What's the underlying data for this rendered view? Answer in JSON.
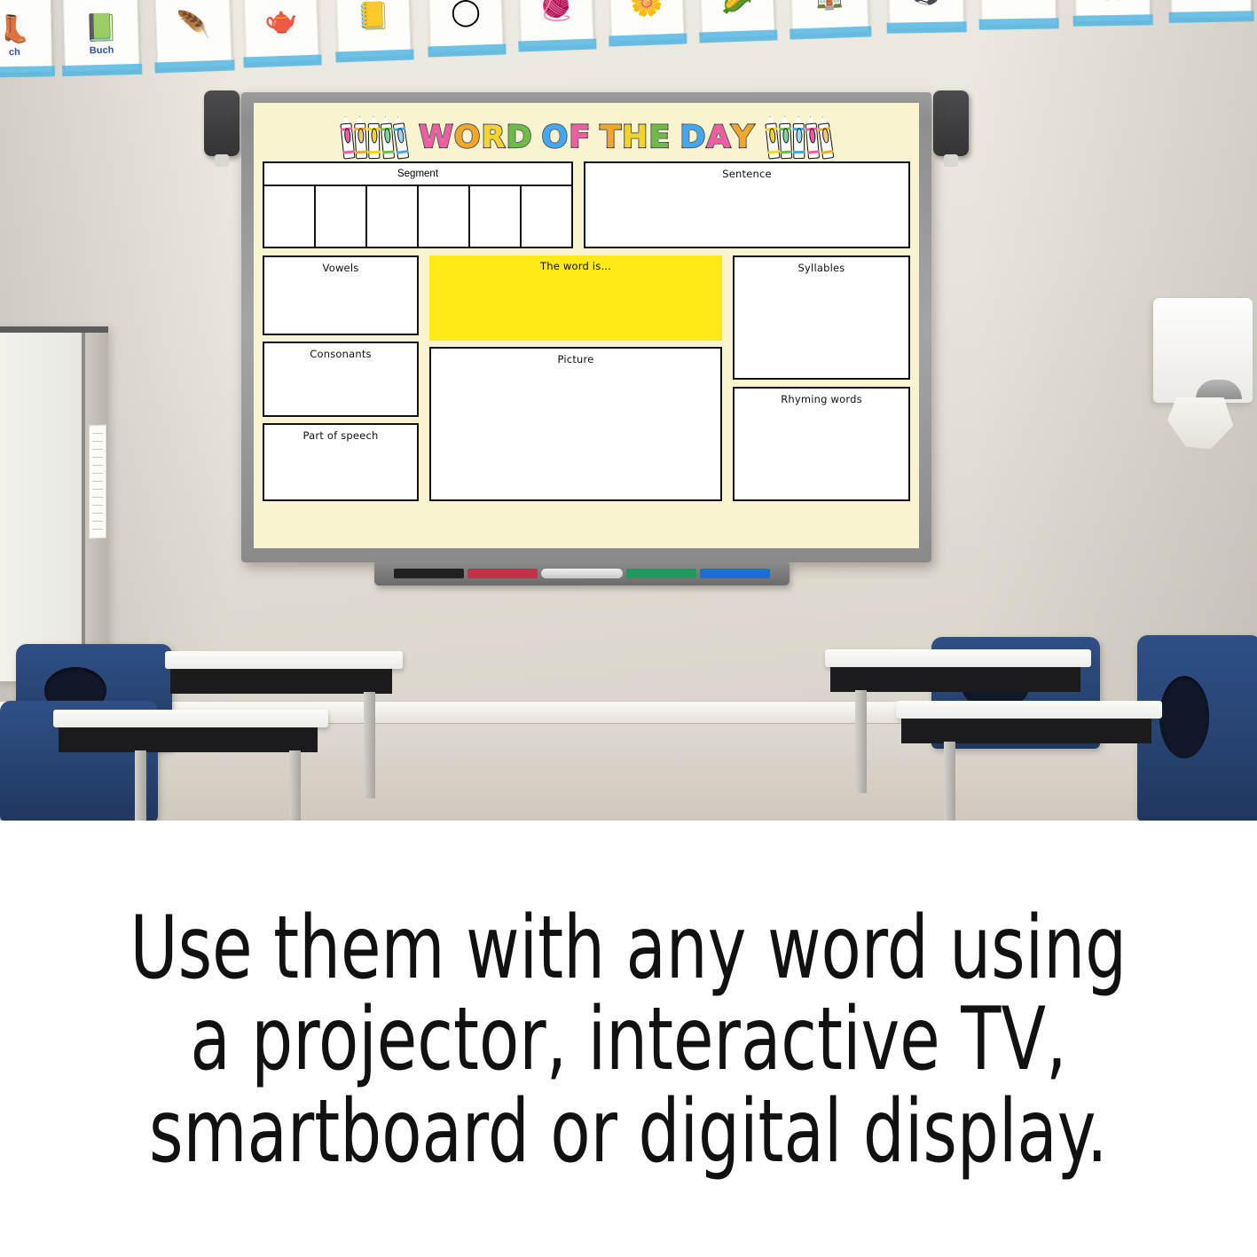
{
  "scene": {
    "type": "classroom-photo",
    "description": "Classroom wall with interactive whiteboard displaying a Word of the Day template"
  },
  "wall_cards": [
    {
      "glyph": "🧒",
      "label": "ch"
    },
    {
      "glyph": "📗",
      "label": "Buch"
    },
    {
      "glyph": "🪺",
      "label": ""
    },
    {
      "glyph": "🫖",
      "label": ""
    },
    {
      "glyph": "📒",
      "label": ""
    },
    {
      "glyph": "⚪",
      "label": ""
    },
    {
      "glyph": "🧶",
      "label": ""
    },
    {
      "glyph": "🌽",
      "label": ""
    },
    {
      "glyph": "🏠",
      "label": ""
    },
    {
      "glyph": "⚽",
      "label": ""
    },
    {
      "glyph": "✂",
      "label": ""
    },
    {
      "glyph": "🍴",
      "label": ""
    },
    {
      "glyph": "✂",
      "label": ""
    }
  ],
  "whiteboard": {
    "device": "interactive whiteboard",
    "speakers": [
      "left-speaker",
      "right-speaker"
    ],
    "pen_tray": {
      "items": [
        {
          "name": "black-marker",
          "color": "#212124"
        },
        {
          "name": "red-marker",
          "color": "#c0344a"
        },
        {
          "name": "eraser",
          "color": "#e4e4e4"
        },
        {
          "name": "green-marker",
          "color": "#1f9a5c"
        },
        {
          "name": "blue-marker",
          "color": "#1a6fd4"
        }
      ]
    }
  },
  "template": {
    "background_color": "#F9F4CF",
    "title": {
      "letters": [
        {
          "char": "W",
          "color": "#F25CA2"
        },
        {
          "char": "O",
          "color": "#F5A623"
        },
        {
          "char": "R",
          "color": "#F5D327"
        },
        {
          "char": "D",
          "color": "#6BBE45"
        },
        {
          "char": "O",
          "color": "#3FA9F5"
        },
        {
          "char": "F",
          "color": "#F25CA2"
        },
        {
          "char": "T",
          "color": "#F5A623"
        },
        {
          "char": "H",
          "color": "#F5D327"
        },
        {
          "char": "E",
          "color": "#6BBE45"
        },
        {
          "char": "D",
          "color": "#3FA9F5"
        },
        {
          "char": "A",
          "color": "#F25CA2"
        },
        {
          "char": "Y",
          "color": "#F5A623"
        }
      ],
      "text": "WORD OF THE DAY"
    },
    "crayons_left": [
      "#F25CA2",
      "#F5A623",
      "#F5D327",
      "#6BBE45",
      "#3FA9F5"
    ],
    "crayons_right": [
      "#F5D327",
      "#6BBE45",
      "#3FA9F5",
      "#F25CA2",
      "#F5A623"
    ],
    "boxes": {
      "segment": {
        "label": "Segment",
        "cells": 6
      },
      "sentence": {
        "label": "Sentence"
      },
      "vowels": {
        "label": "Vowels"
      },
      "consonants": {
        "label": "Consonants"
      },
      "part_of_speech": {
        "label": "Part of speech"
      },
      "the_word_is": {
        "label": "The word is...",
        "fill": "#FFE916"
      },
      "picture": {
        "label": "Picture"
      },
      "syllables": {
        "label": "Syllables"
      },
      "rhyming": {
        "label": "Rhyming words"
      }
    }
  },
  "furniture": {
    "chairs": 4,
    "desks": 3,
    "chair_color": "#27446f",
    "desk_top_color": "#fbfbf9"
  },
  "caption": {
    "line1": "Use them with any word using",
    "line2": "a projector, interactive TV,",
    "line3": "smartboard or digital display."
  }
}
